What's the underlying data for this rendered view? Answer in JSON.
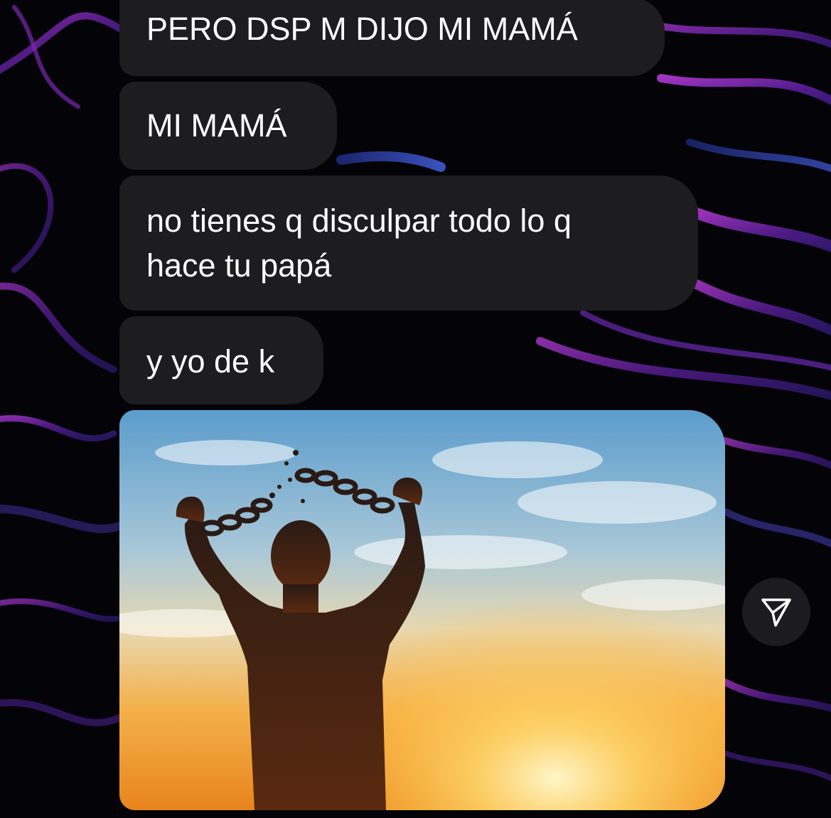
{
  "conversation": {
    "messages": [
      {
        "lines": [
          "PERO DSP M DIJO MI MAMÁ"
        ]
      },
      {
        "lines": [
          "MI MAMÁ"
        ]
      },
      {
        "lines": [
          "no tienes q disculpar todo lo q",
          "hace tu papá"
        ]
      },
      {
        "lines": [
          "y yo de k"
        ]
      }
    ],
    "photo_icon": "broken-chains-silhouette-photo",
    "share_icon": "paper-plane-icon"
  },
  "colors": {
    "bubble": "#1d1c1f",
    "text": "#ffffff",
    "wallpaper_accent": "#8a2fb8"
  }
}
